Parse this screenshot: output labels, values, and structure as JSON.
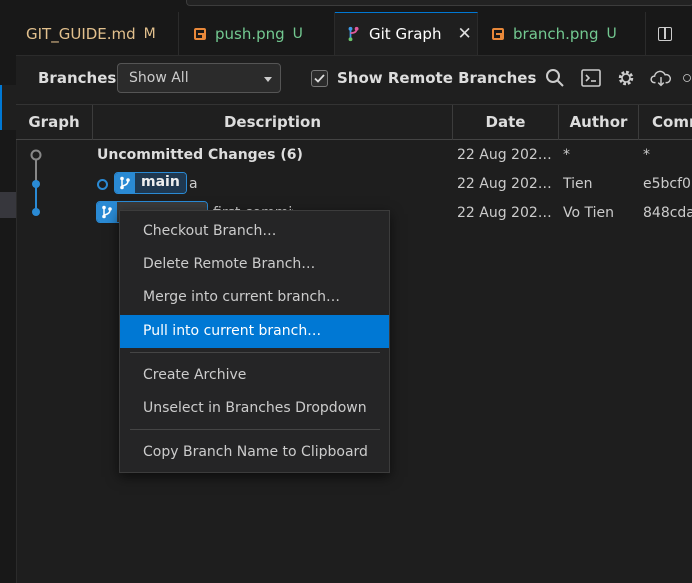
{
  "tabs": [
    {
      "label": "GIT_GUIDE.md",
      "status": "M"
    },
    {
      "label": "push.png",
      "status": "U"
    },
    {
      "label": "Git Graph",
      "status": ""
    },
    {
      "label": "branch.png",
      "status": "U"
    }
  ],
  "toolbar": {
    "branches_label": "Branches:",
    "branches_value": "Show All",
    "show_remote_label": "Show Remote Branches",
    "show_remote_checked": true
  },
  "table": {
    "headers": [
      "Graph",
      "Description",
      "Date",
      "Author",
      "Comm"
    ],
    "rows": [
      {
        "description": "Uncommitted Changes (6)",
        "date": "22 Aug 202…",
        "author": "*",
        "commit": "*"
      },
      {
        "ref": "main",
        "description": "a",
        "date": "22 Aug 202…",
        "author": "Tien",
        "commit": "e5bcf0"
      },
      {
        "ref": "",
        "description": "first commit",
        "date": "22 Aug 202…",
        "author": "Vo Tien",
        "commit": "848cda"
      }
    ]
  },
  "context_menu": {
    "items": [
      "Checkout Branch…",
      "Delete Remote Branch…",
      "Merge into current branch…",
      "Pull into current branch…",
      "Create Archive",
      "Unselect in Branches Dropdown",
      "Copy Branch Name to Clipboard"
    ],
    "selected": "Pull into current branch…"
  },
  "colors": {
    "accent": "#0078d4",
    "graph": "#2a8ad4",
    "modified": "#e2c08d",
    "untracked": "#73c991"
  }
}
